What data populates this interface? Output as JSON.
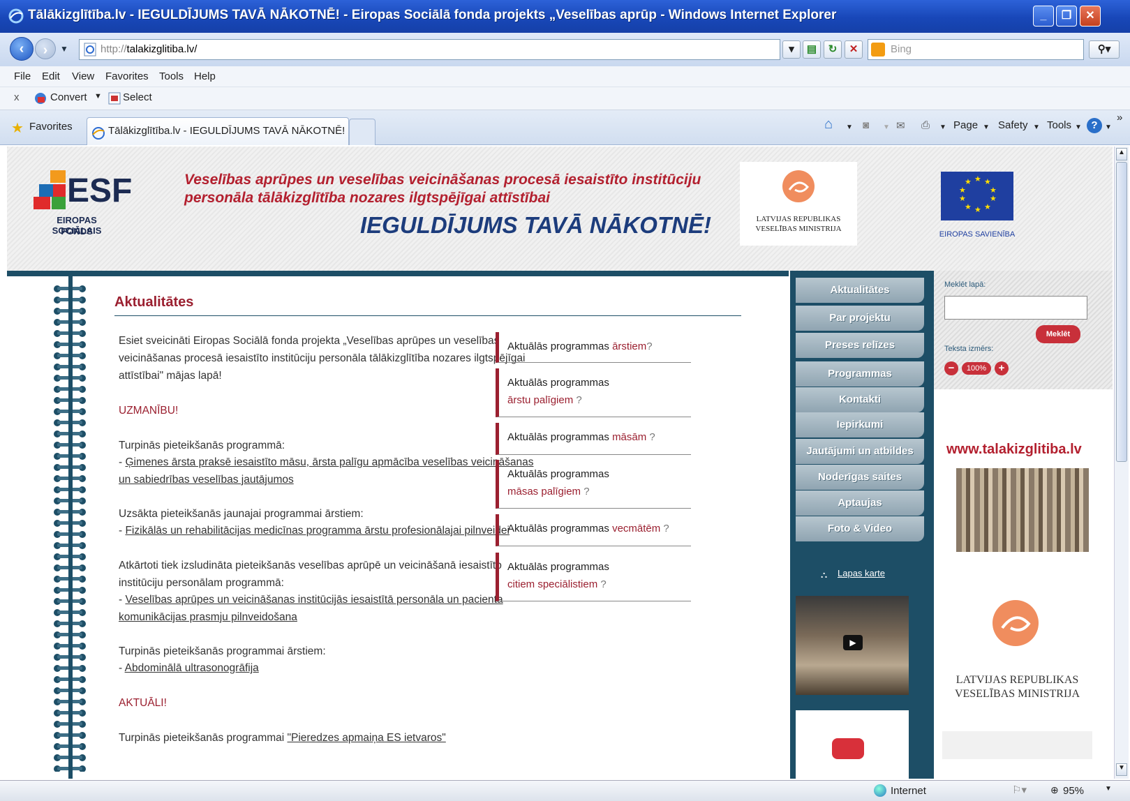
{
  "window": {
    "title": "Tālākizglītība.lv - IEGULDĪJUMS TAVĀ NĀKOTNĒ! - Eiropas Sociālā fonda projekts „Veselības aprūp - Windows Internet Explorer",
    "minimize": "_",
    "maximize": "❐",
    "close": "✕"
  },
  "address": {
    "protocol": "http://",
    "host": "talakizglitiba.lv/",
    "search_placeholder": "Bing"
  },
  "menu": [
    "File",
    "Edit",
    "View",
    "Favorites",
    "Tools",
    "Help"
  ],
  "cmdbar": {
    "close": "x",
    "convert": "Convert",
    "select": "Select"
  },
  "tabs": {
    "favorites": "Favorites",
    "active_tab": "Tālākizglītība.lv - IEGULDĪJUMS TAVĀ NĀKOTNĒ! - Eiro..."
  },
  "toolbar": {
    "page": "Page",
    "safety": "Safety",
    "tools": "Tools"
  },
  "header": {
    "esf_logo": "ESF",
    "esf_sub1": "EIROPAS SOCIĀLAIS",
    "esf_sub2": "FONDS",
    "tagline1": "Veselības aprūpes un veselības veicināšanas procesā iesaistīto institūciju",
    "tagline2": "personāla tālākizglītība nozares ilgtspējīgai attīstībai",
    "slogan": "IEGULDĪJUMS TAVĀ NĀKOTNĒ!",
    "ministry1": "LATVIJAS REPUBLIKAS",
    "ministry2": "VESELĪBAS MINISTRIJA",
    "eu_label": "EIROPAS SAVIENĪBA"
  },
  "content": {
    "heading": "Aktualitātes",
    "intro": "Esiet sveicināti Eiropas Sociālā fonda projekta „Veselības aprūpes un veselības veicināšanas procesā iesaistīto institūciju personāla tālākizglītība nozares ilgtspējīgai attīstībai\" mājas lapā!",
    "attention": "UZMANĪBU!",
    "p1_title": "Turpinās pieteikšanās programmā:",
    "p1_link": "Ģimenes ārsta praksē iesaistīto māsu, ārsta palīgu apmācība veselības veicināšanas un sabiedrības veselības jautājumos",
    "p2_title": "Uzsākta pieteikšanās jaunajai programmai ārstiem:",
    "p2_link": "Fizikālās un rehabilitācijas medicīnas programma ārstu profesionālajai pilnveidei",
    "p3_title": "Atkārtoti tiek izsludināta pieteikšanās veselības aprūpē un veicināšanā iesaistīto institūciju personālam programmā:",
    "p3_link": "Veselības aprūpes un veicināšanas institūcijās iesaistītā personāla un pacienta komunikācijas prasmju pilnveidošana",
    "p4_title": "Turpinās pieteikšanās programmai ārstiem:",
    "p4_link": "Abdominālā ultrasonogrāfija",
    "actual": "AKTUĀLI!",
    "p5_title": "Turpinās pieteikšanās programmai",
    "p5_link": "\"Pieredzes apmaiņa ES ietvaros\"",
    "dash": "- "
  },
  "programs": [
    {
      "prefix": "Aktuālās programmas ",
      "target": "ārstiem",
      "q": "?"
    },
    {
      "prefix": "Aktuālās programmas",
      "target": "ārstu palīgiem",
      "q": " ?"
    },
    {
      "prefix": "Aktuālās programmas ",
      "target": "māsām",
      "q": " ?"
    },
    {
      "prefix": "Aktuālās programmas",
      "target": "māsas palīgiem",
      "q": " ?"
    },
    {
      "prefix": "Aktuālās programmas ",
      "target": "vecmātēm",
      "q": " ?"
    },
    {
      "prefix": "Aktuālās programmas",
      "target": "citiem speciālistiem",
      "q": " ?"
    }
  ],
  "nav": [
    "Aktualitātes",
    "Par projektu",
    "Preses relīzes",
    "Programmas",
    "Kontakti",
    "Iepirkumi",
    "Jautājumi un atbildes",
    "Noderīgas saites",
    "Aptaujas",
    "Foto & Video"
  ],
  "sitemap": "Lapas karte",
  "search": {
    "label": "Meklēt lapā:",
    "button": "Meklēt",
    "text_size_label": "Teksta izmērs:",
    "text_size_value": "100%"
  },
  "banner_url": "www.talakizglitiba.lv",
  "status": {
    "zone": "Internet",
    "zoom": "95%"
  },
  "colors": {
    "accent": "#9b2030",
    "nav_bg": "#1d4e66",
    "titlebar": "#1847b8"
  }
}
